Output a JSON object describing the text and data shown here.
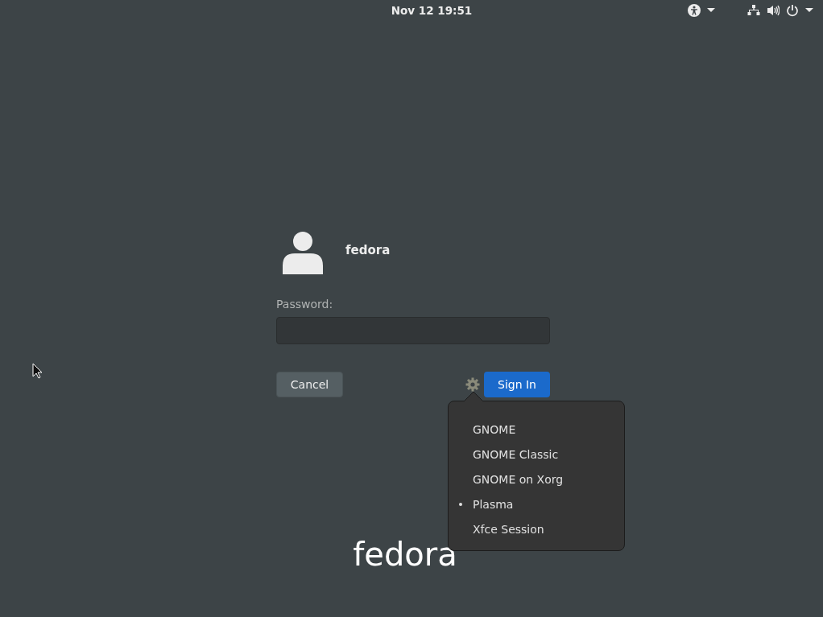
{
  "top_bar": {
    "clock": "Nov 12  19:51"
  },
  "user": {
    "name": "fedora"
  },
  "password": {
    "label": "Password:"
  },
  "buttons": {
    "cancel": "Cancel",
    "sign_in": "Sign In"
  },
  "session_menu": {
    "items": [
      {
        "label": "GNOME",
        "selected": false
      },
      {
        "label": "GNOME Classic",
        "selected": false
      },
      {
        "label": "GNOME on Xorg",
        "selected": false
      },
      {
        "label": "Plasma",
        "selected": true
      },
      {
        "label": "Xfce Session",
        "selected": false
      }
    ]
  },
  "logo": {
    "text": "fedora"
  }
}
